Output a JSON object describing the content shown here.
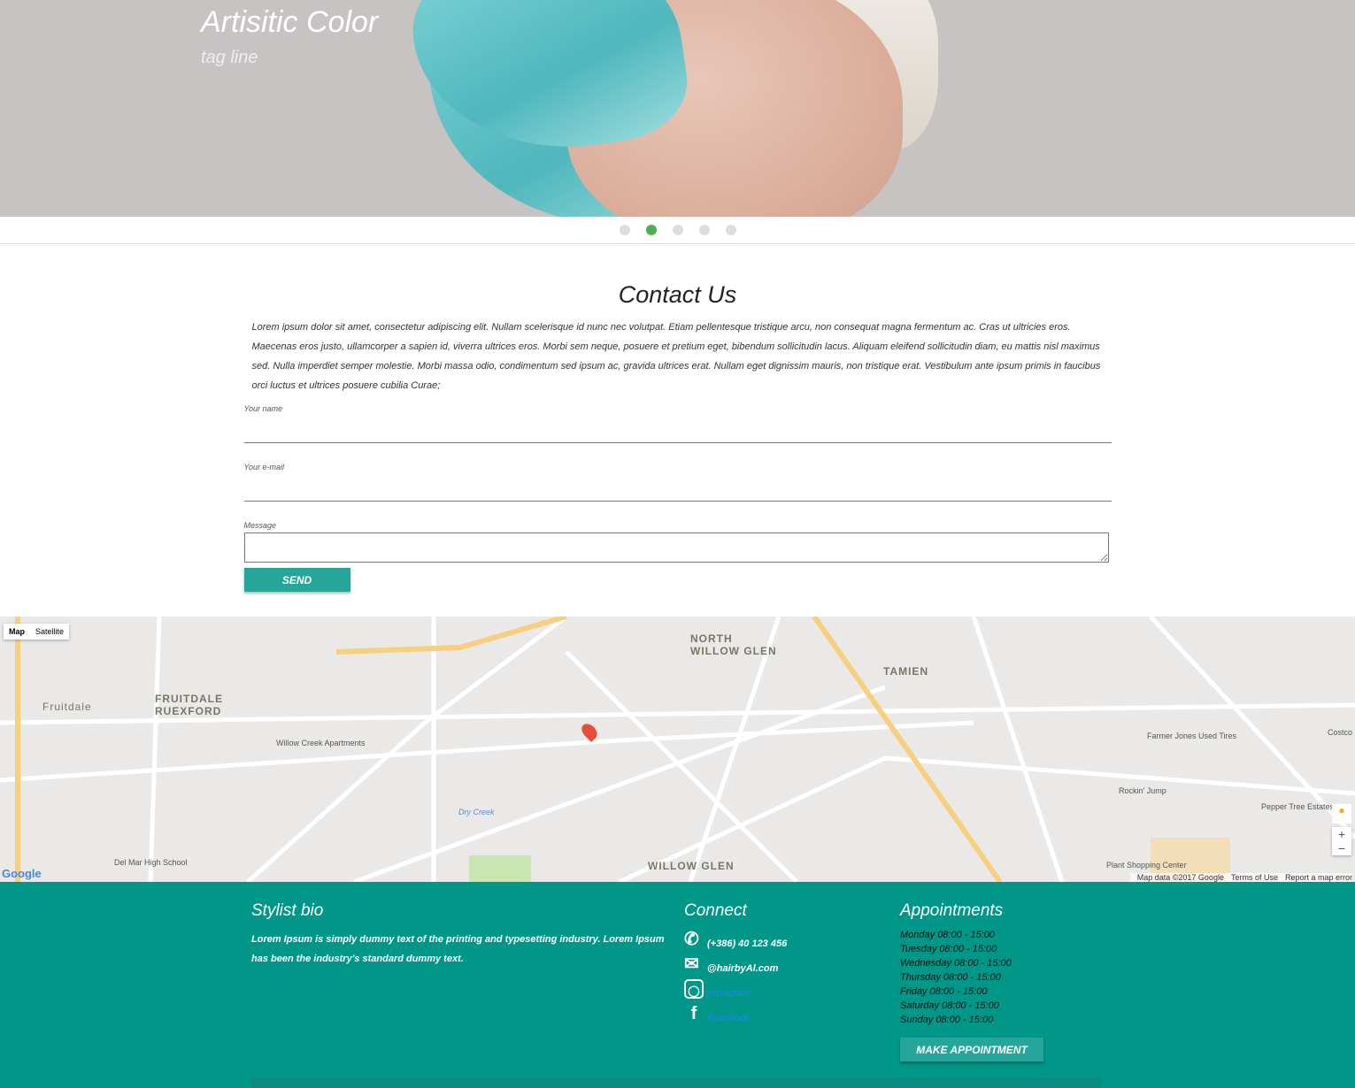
{
  "hero": {
    "title": "Artisitic Color",
    "tagline": "tag line"
  },
  "slider": {
    "count": 5,
    "active_index": 1,
    "accent": "#4caf50"
  },
  "contact": {
    "title": "Contact Us",
    "text": "Lorem ipsum dolor sit amet, consectetur adipiscing elit. Nullam scelerisque id nunc nec volutpat. Etiam pellentesque tristique arcu, non consequat magna fermentum ac. Cras ut ultricies eros. Maecenas eros justo, ullamcorper a sapien id, viverra ultrices eros. Morbi sem neque, posuere et pretium eget, bibendum sollicitudin lacus. Aliquam eleifend sollicitudin diam, eu mattis nisl maximus sed. Nulla imperdiet semper molestie. Morbi massa odio, condimentum sed ipsum ac, gravida ultrices erat. Nullam eget dignissim mauris, non tristique erat. Vestibulum ante ipsum primis in faucibus orci luctus et ultrices posuere cubilia Curae;",
    "name_label": "Your name",
    "email_label": "Your e-mail",
    "message_label": "Message",
    "send_label": "SEND"
  },
  "map": {
    "type_map": "Map",
    "type_satellite": "Satellite",
    "labels": [
      "NORTH WILLOW GLEN",
      "TAMIEN",
      "FRUITDALE RUEXFORD",
      "WILLOW GLEN",
      "Fruitdale",
      "Willow Creek Apartments",
      "Del Mar High School",
      "Farmer Jones Used Tires",
      "Rockin' Jump",
      "Pepper Tree Estates",
      "Plant Shopping Center",
      "Dry Creek",
      "Costco"
    ],
    "attribution": "Map data ©2017 Google",
    "terms": "Terms of Use",
    "report": "Report a map error",
    "logo": "Google",
    "zoom_in": "+",
    "zoom_out": "−"
  },
  "footer": {
    "bio_title": "Stylist bio",
    "bio_text": "Lorem Ipsum is simply dummy text of the printing and typesetting industry. Lorem Ipsum has been the industry's standard dummy text.",
    "connect_title": "Connect",
    "phone": "(+386) 40 123 456",
    "email": "@hairbyAl.com",
    "instagram": "Instagram",
    "facebook": "Facebook",
    "appointments_title": "Appointments",
    "hours": [
      "Monday 08:00 - 15:00",
      "Tuesday 08:00 - 15:00",
      "Wednesday 08:00 - 15:00",
      "Thursday 08:00 - 15:00",
      "Friday 08:00 - 15:00",
      "Saturday 08:00 - 15:00",
      "Sunday 08:00 - 15:00"
    ],
    "appointment_button": "MAKE APPOINTMENT"
  },
  "colors": {
    "teal": "#009688",
    "button": "#26a69a",
    "link": "#1e88e5"
  }
}
